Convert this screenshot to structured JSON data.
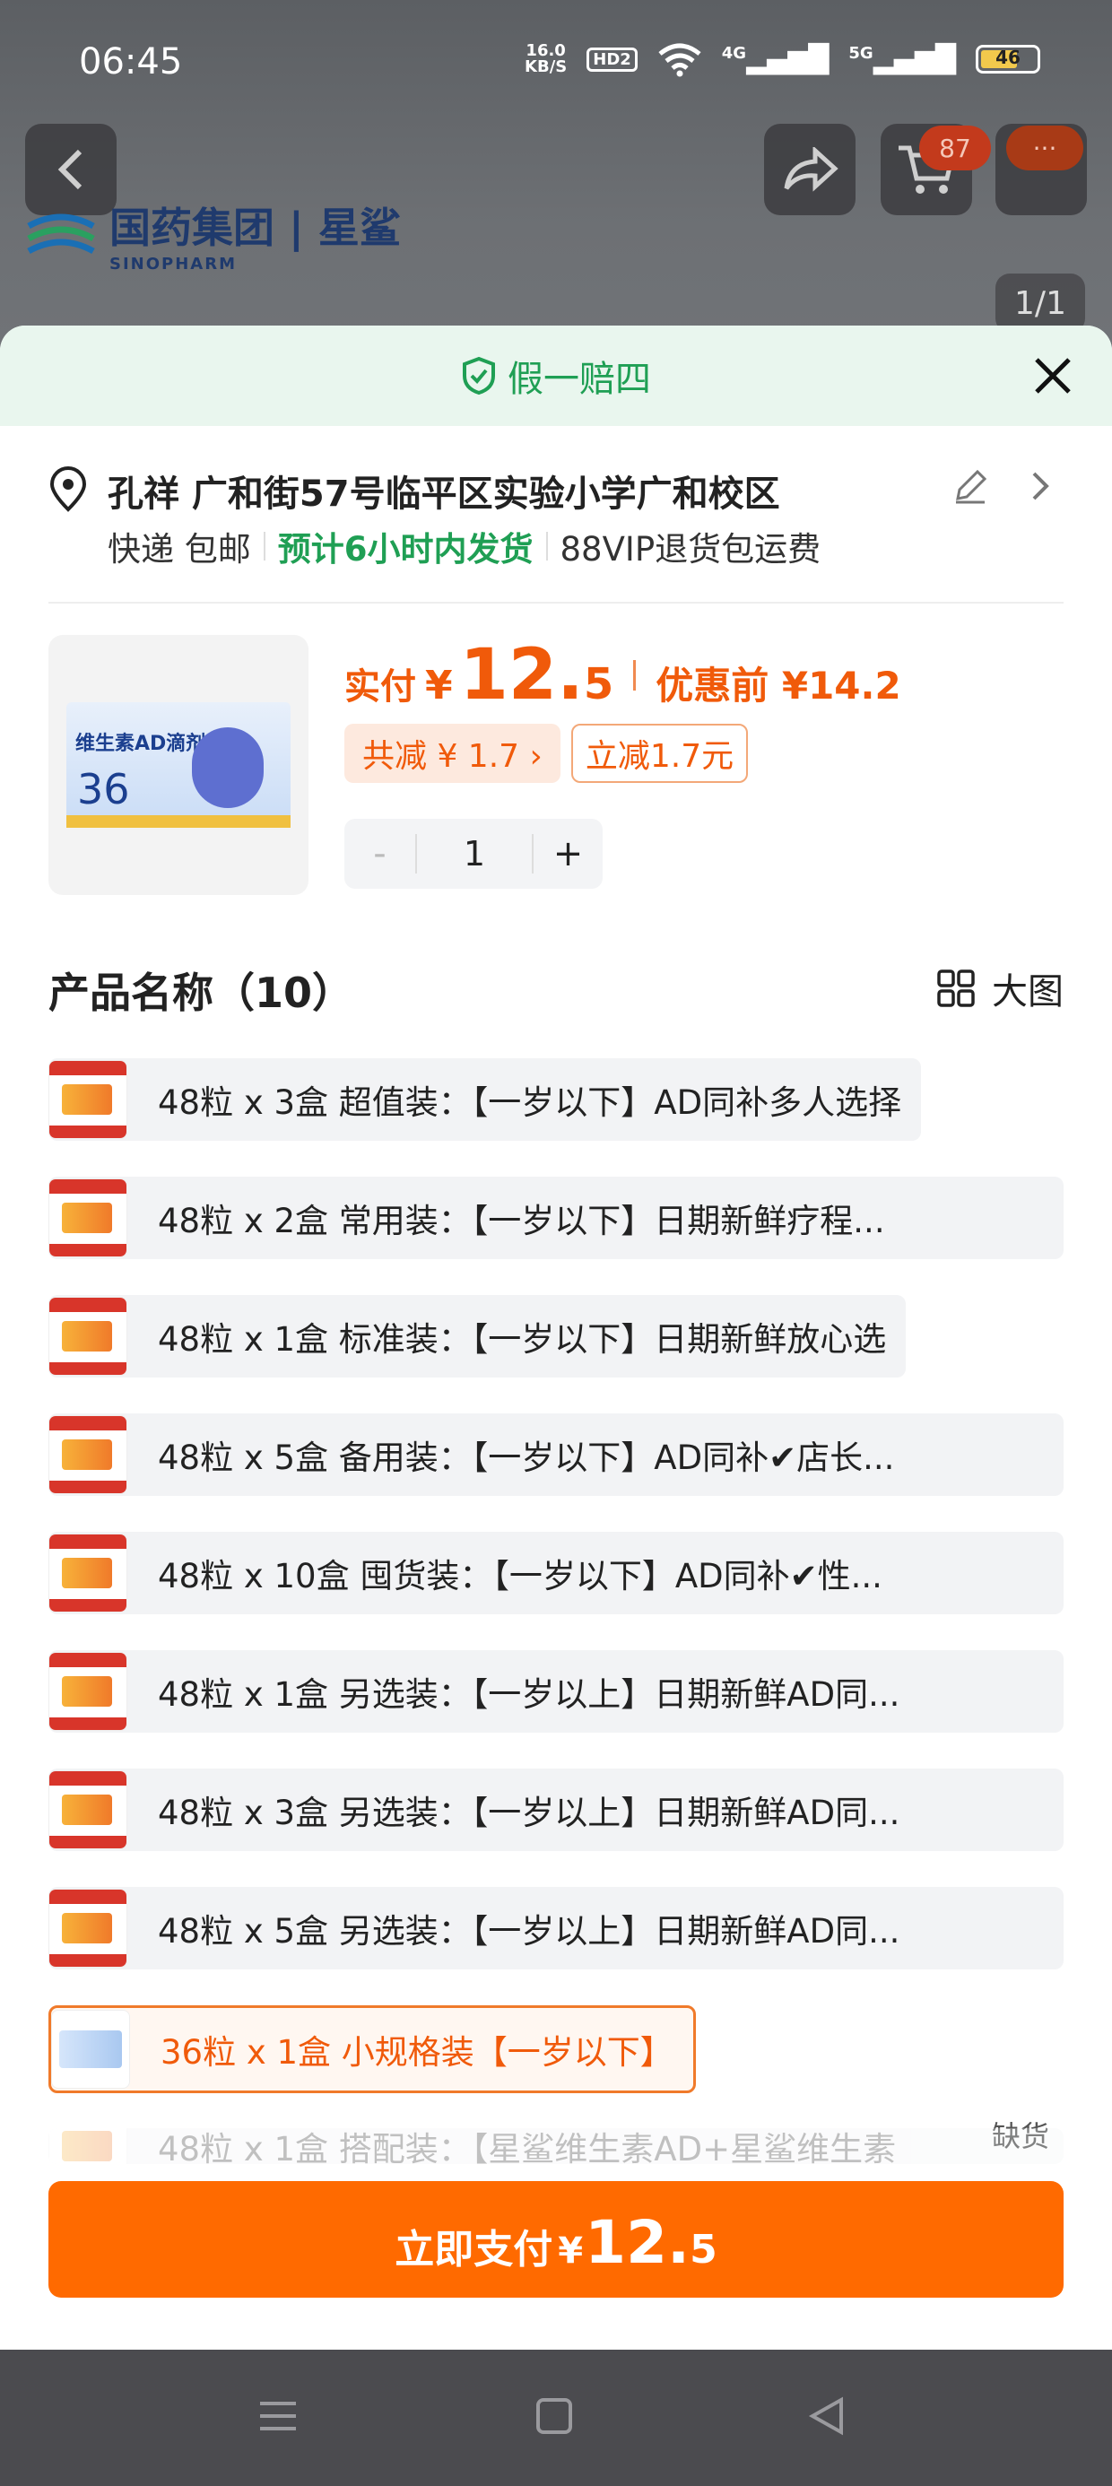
{
  "status_bar": {
    "time": "06:45",
    "net_speed_value": "16.0",
    "net_speed_unit": "KB/S",
    "hd_badge": "HD2",
    "signal_1": "4G",
    "signal_2": "5G",
    "battery": "46"
  },
  "background": {
    "cart_count": "87",
    "more_label": "···",
    "brand_cn": "国药集团 | 星鲨",
    "brand_en": "SINOPHARM",
    "pager": "1/1"
  },
  "sheet": {
    "guarantee": "假一赔四",
    "address": {
      "name_line": "孔祥 广和街57号临平区实验小学广和校区",
      "shipping": "快递 包邮",
      "eta": "预计6小时内发货",
      "vip": "88VIP退货包运费"
    },
    "product": {
      "image_title": "维生素AD滴剂",
      "image_count": "36",
      "price_label": "实付",
      "currency": "¥",
      "price_int": "12.",
      "price_dec": "5",
      "pre_price": "优惠前 ¥14.2",
      "discount_chip": "共减 ¥ 1.7 ›",
      "instant_chip": "立减1.7元",
      "qty_minus": "-",
      "qty": "1",
      "qty_plus": "+"
    },
    "section": {
      "title": "产品名称（10）",
      "big_view": "大图"
    },
    "options": [
      {
        "label": "48粒 x 3盒 超值装：【一岁以下】AD同补多人选择"
      },
      {
        "label": "48粒 x 2盒 常用装：【一岁以下】日期新鲜疗程..."
      },
      {
        "label": "48粒 x 1盒 标准装：【一岁以下】日期新鲜放心选"
      },
      {
        "label": "48粒 x 5盒 备用装：【一岁以下】AD同补✔店长..."
      },
      {
        "label": "48粒 x 10盒 囤货装：【一岁以下】AD同补✔性..."
      },
      {
        "label": "48粒 x 1盒 另选装：【一岁以上】日期新鲜AD同..."
      },
      {
        "label": "48粒 x 3盒 另选装：【一岁以上】日期新鲜AD同..."
      },
      {
        "label": "48粒 x 5盒 另选装：【一岁以上】日期新鲜AD同..."
      },
      {
        "label": "36粒 x 1盒 小规格装【一岁以下】"
      },
      {
        "label": "48粒 x 1盒 搭配装：【星鲨维生素AD+星鲨维生素"
      }
    ],
    "sold_out": "缺货",
    "pay_button": {
      "label": "立即支付",
      "currency": "¥",
      "int": "12.",
      "dec": "5"
    }
  }
}
